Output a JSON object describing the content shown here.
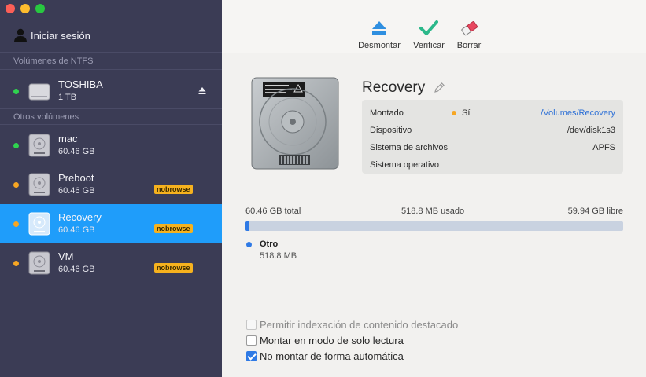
{
  "sidebar": {
    "login_label": "Iniciar sesión",
    "sections": {
      "ntfs": "Volúmenes de NTFS",
      "otros": "Otros volúmenes"
    },
    "volumes": [
      {
        "name": "TOSHIBA",
        "size": "1 TB",
        "status": "green",
        "badge": ""
      },
      {
        "name": "mac",
        "size": "60.46 GB",
        "status": "green",
        "badge": ""
      },
      {
        "name": "Preboot",
        "size": "60.46 GB",
        "status": "orange",
        "badge": "nobrowse"
      },
      {
        "name": "Recovery",
        "size": "60.46 GB",
        "status": "orange",
        "badge": "nobrowse",
        "selected": true
      },
      {
        "name": "VM",
        "size": "60.46 GB",
        "status": "orange",
        "badge": "nobrowse"
      }
    ]
  },
  "toolbar": {
    "unmount_label": "Desmontar",
    "verify_label": "Verificar",
    "erase_label": "Borrar"
  },
  "detail": {
    "title": "Recovery",
    "info": {
      "mounted_label": "Montado",
      "mounted_value": "Sí",
      "mount_path": "/Volumes/Recovery",
      "device_label": "Dispositivo",
      "device_value": "/dev/disk1s3",
      "fs_label": "Sistema de archivos",
      "fs_value": "APFS",
      "os_label": "Sistema operativo",
      "os_value": ""
    },
    "usage": {
      "total": "60.46 GB total",
      "used": "518.8 MB usado",
      "free": "59.94 GB libre",
      "used_fraction": 0.0086
    },
    "legend": {
      "name": "Otro",
      "size": "518.8 MB"
    },
    "options": [
      {
        "label": "Permitir indexación de contenido destacado",
        "checked": false,
        "disabled": true
      },
      {
        "label": "Montar en modo de solo lectura",
        "checked": false,
        "disabled": false
      },
      {
        "label": "No montar de forma automática",
        "checked": true,
        "disabled": false
      }
    ]
  },
  "colors": {
    "sidebar_bg": "#3b3c55",
    "selection": "#1f9dfa",
    "accent": "#2f7ae5",
    "status_green": "#2fd34f",
    "status_orange": "#f6a623",
    "badge": "#f6b21e"
  }
}
